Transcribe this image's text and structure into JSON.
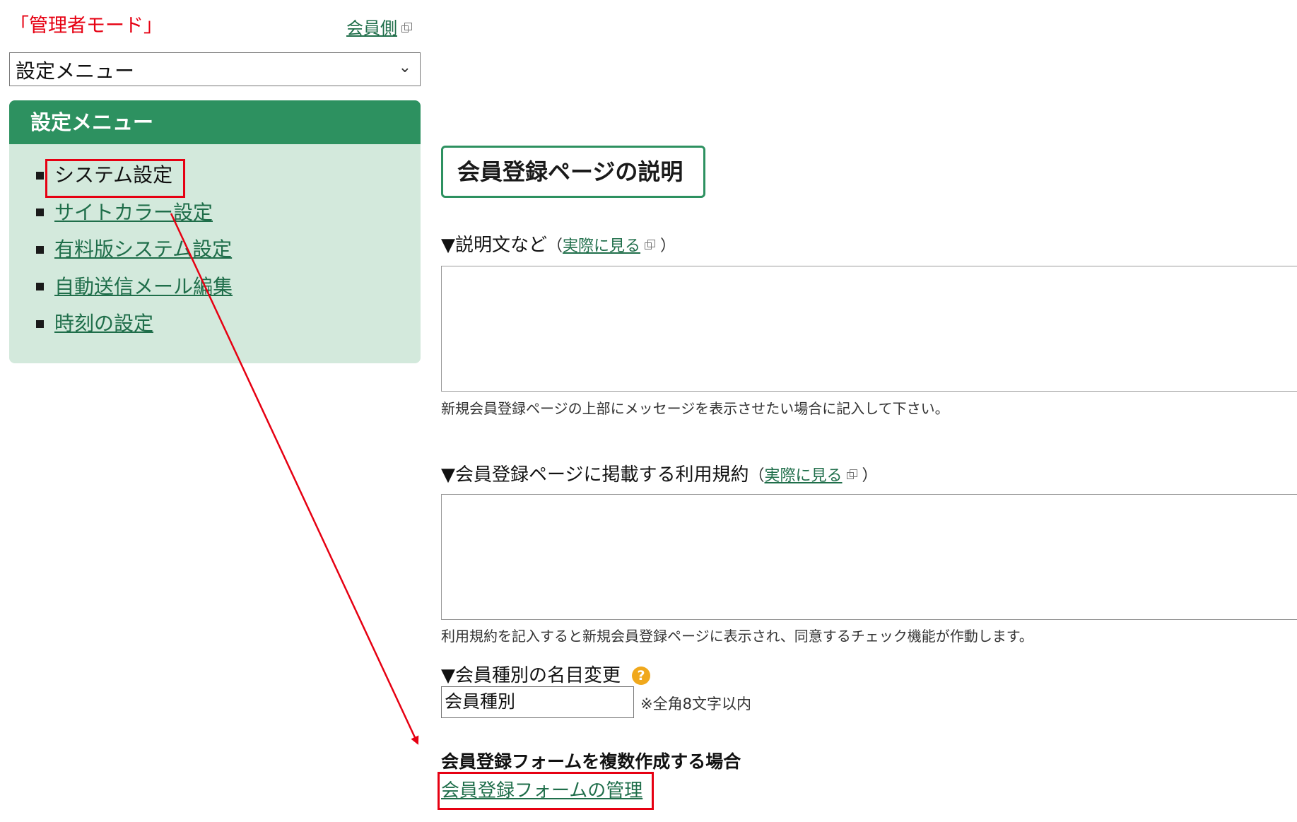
{
  "header": {
    "mode_label": "「管理者モード」",
    "member_side_link": "会員側"
  },
  "menu_select": {
    "selected": "設定メニュー"
  },
  "settings_panel": {
    "title": "設定メニュー",
    "items": [
      {
        "label": "システム設定",
        "current": true
      },
      {
        "label": "サイトカラー設定"
      },
      {
        "label": "有料版システム設定"
      },
      {
        "label": "自動送信メール編集"
      },
      {
        "label": "時刻の設定"
      }
    ]
  },
  "main": {
    "section_title": "会員登録ページの説明",
    "description": {
      "label": "▼説明文など",
      "view_link": "実際に見る",
      "hint": "新規会員登録ページの上部にメッセージを表示させたい場合に記入して下さい。"
    },
    "terms": {
      "label": "▼会員登録ページに掲載する利用規約",
      "view_link": "実際に見る",
      "hint": "利用規約を記入すると新規会員登録ページに表示され、同意するチェック機能が作動します。"
    },
    "member_type": {
      "label": "▼会員種別の名目変更",
      "value": "会員種別",
      "note": "※全角8文字以内"
    },
    "multi_form": {
      "heading": "会員登録フォームを複数作成する場合",
      "link": "会員登録フォームの管理"
    }
  },
  "colors": {
    "accent_green": "#2d9160",
    "panel_bg": "#d3e9dc",
    "link": "#1f6e4a",
    "highlight_red": "#e60012",
    "help_orange": "#f0a81c"
  }
}
